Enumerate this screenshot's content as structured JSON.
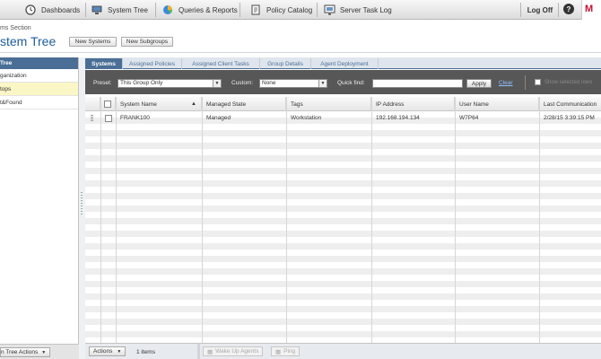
{
  "nav": {
    "items": [
      {
        "label": "Dashboards",
        "icon": "clock-icon"
      },
      {
        "label": "System Tree",
        "icon": "computer-icon"
      },
      {
        "label": "Queries & Reports",
        "icon": "pie-chart-icon"
      },
      {
        "label": "Policy Catalog",
        "icon": "document-icon"
      },
      {
        "label": "Server Task Log",
        "icon": "monitor-icon"
      }
    ],
    "logoff": "Log Off",
    "help": "?",
    "brand_text": "M",
    "brand_color": "#c8102e"
  },
  "header": {
    "section": "ms Section",
    "title": "stem Tree",
    "new_systems": "New Systems",
    "new_subgroups": "New Subgroups"
  },
  "tree": {
    "header": "Tree",
    "items": [
      {
        "label": "ganization",
        "selected": false
      },
      {
        "label": "tops",
        "selected": true
      },
      {
        "label": "t&Found",
        "selected": false
      }
    ],
    "actions": "n Tree Actions"
  },
  "tabs": [
    {
      "label": "Systems",
      "active": true
    },
    {
      "label": "Assigned Policies",
      "active": false
    },
    {
      "label": "Assigned Client Tasks",
      "active": false
    },
    {
      "label": "Group Details",
      "active": false
    },
    {
      "label": "Agent Deployment",
      "active": false
    }
  ],
  "filter": {
    "preset_label": "Preset:",
    "preset_value": "This Group Only",
    "custom_label": "Custom:",
    "custom_value": "None",
    "quickfind_label": "Quick find:",
    "quickfind_value": "",
    "apply": "Apply",
    "clear": "Clear",
    "show_selected": "Show selected rows"
  },
  "table": {
    "columns": [
      "System Name",
      "Managed State",
      "Tags",
      "IP Address",
      "User Name",
      "Last Communication"
    ],
    "sort_indicator": "▲",
    "rows": [
      {
        "system_name": "FRANK100",
        "managed_state": "Managed",
        "tags": "Workstation",
        "ip_address": "192.168.194.134",
        "user_name": "W7P64",
        "last_communication": "2/28/15 3:39:15 PM"
      }
    ]
  },
  "bottom": {
    "actions": "Actions",
    "count": "1 items",
    "wake_up": "Wake Up Agents",
    "ping": "Ping"
  }
}
